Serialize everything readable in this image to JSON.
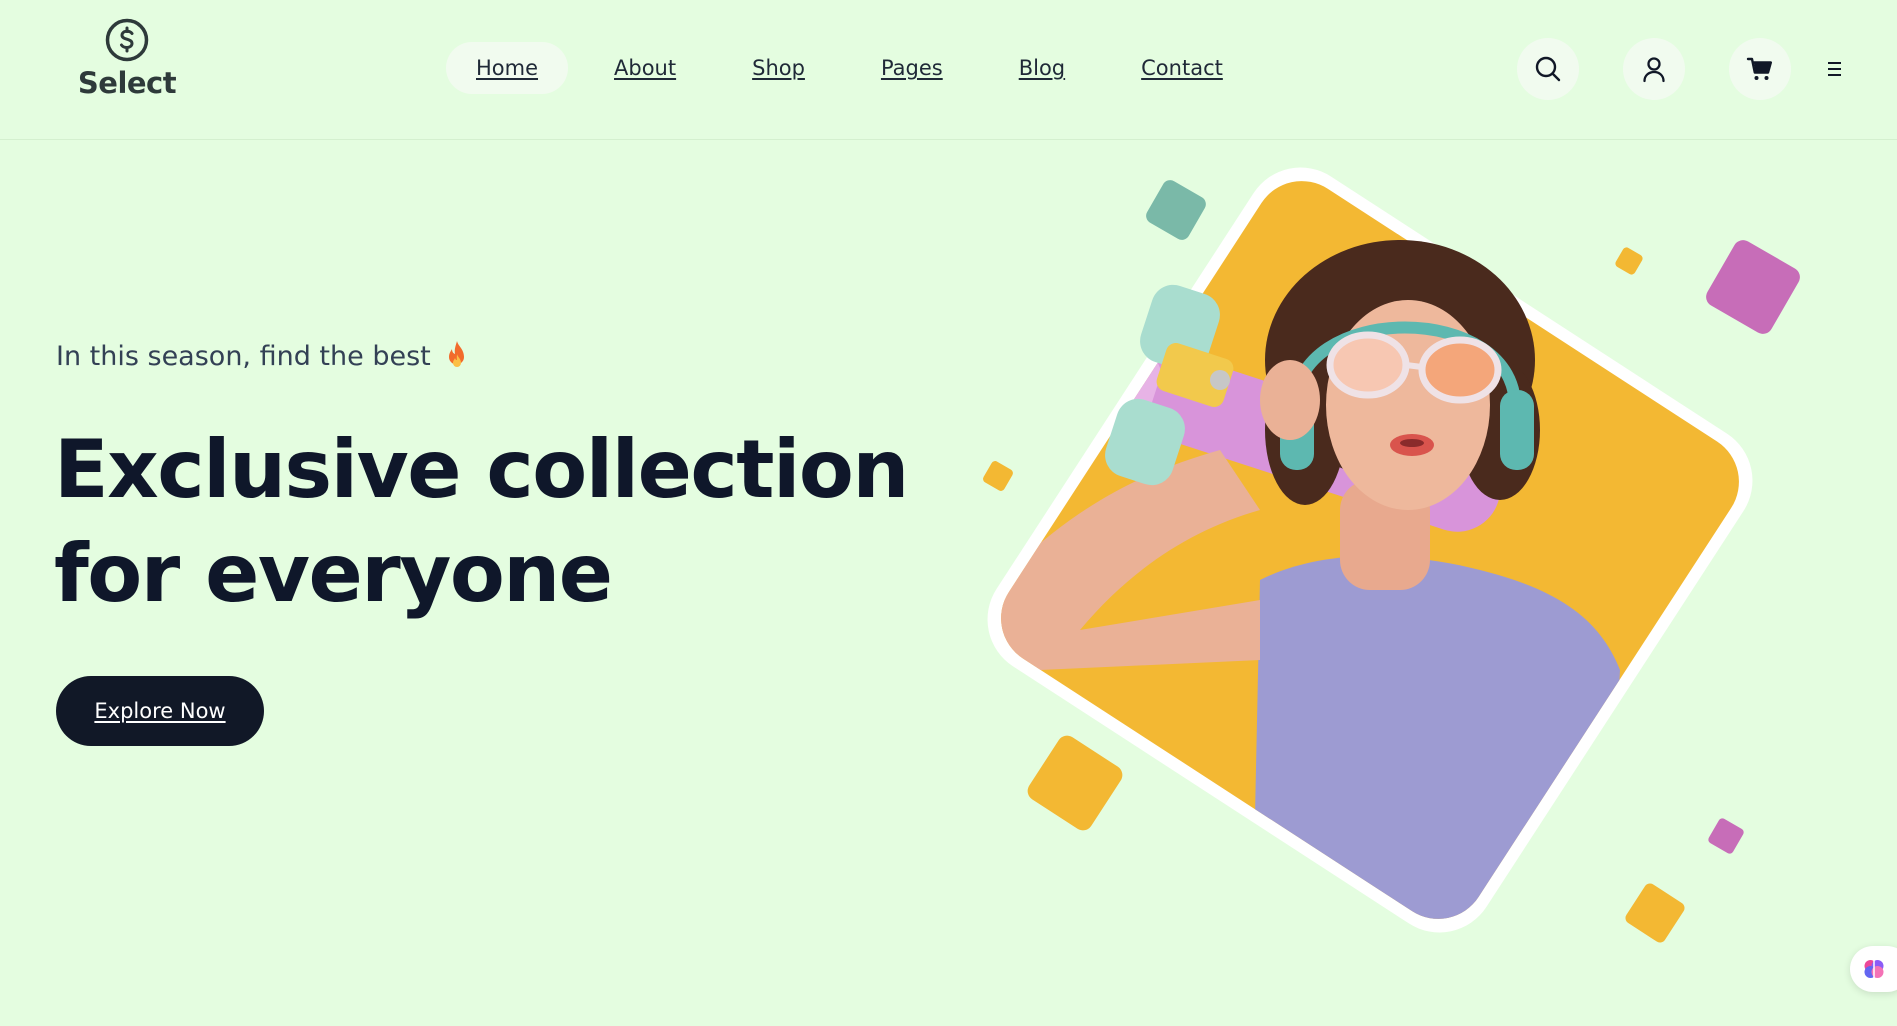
{
  "brand": {
    "name": "Select"
  },
  "nav": {
    "items": [
      {
        "label": "Home",
        "active": true
      },
      {
        "label": "About"
      },
      {
        "label": "Shop"
      },
      {
        "label": "Pages"
      },
      {
        "label": "Blog"
      },
      {
        "label": "Contact"
      }
    ]
  },
  "header_icons": [
    "search-icon",
    "user-icon",
    "cart-icon",
    "menu-icon"
  ],
  "hero": {
    "tagline": "In this season, find the best",
    "tagline_icon": "fire-icon",
    "title_line1": "Exclusive collection",
    "title_line2": "for everyone",
    "cta_label": "Explore Now"
  },
  "colors": {
    "background": "#e4fde0",
    "dark": "#111827",
    "accent_yellow": "#f3b833",
    "accent_pink": "#c76db8",
    "accent_teal": "#7ab9a8",
    "shirt": "#9d9bd2"
  }
}
